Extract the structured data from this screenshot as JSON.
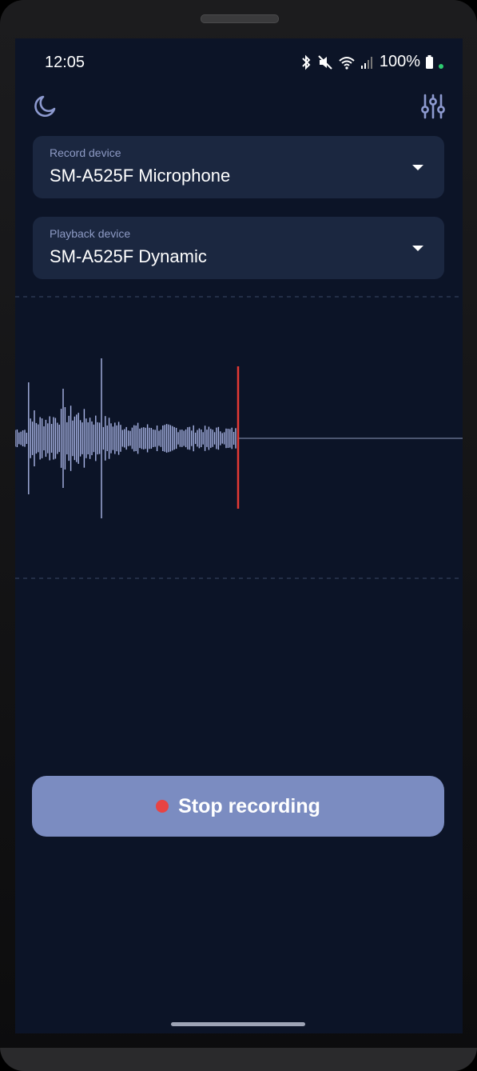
{
  "status_bar": {
    "time": "12:05",
    "battery": "100%",
    "icons": [
      "bluetooth-icon",
      "mute-icon",
      "wifi-icon",
      "signal-icon",
      "battery-icon"
    ]
  },
  "toolbar": {
    "left_icon": "moon-icon",
    "right_icon": "sliders-icon"
  },
  "record_device": {
    "label": "Record device",
    "value": "SM-A525F Microphone"
  },
  "playback_device": {
    "label": "Playback device",
    "value": "SM-A525F Dynamic"
  },
  "waveform": {
    "colors": {
      "bars": "#a9b4e6",
      "playhead": "#e53935",
      "baseline": "#8d97b8",
      "guide": "#3a4766"
    }
  },
  "stop_button": {
    "label": "Stop recording",
    "color": "#7b8cc1",
    "dot_color": "#e84343"
  },
  "colors": {
    "background": "#0c1427",
    "card": "#1b2740",
    "card_label": "#8d9ac4"
  }
}
